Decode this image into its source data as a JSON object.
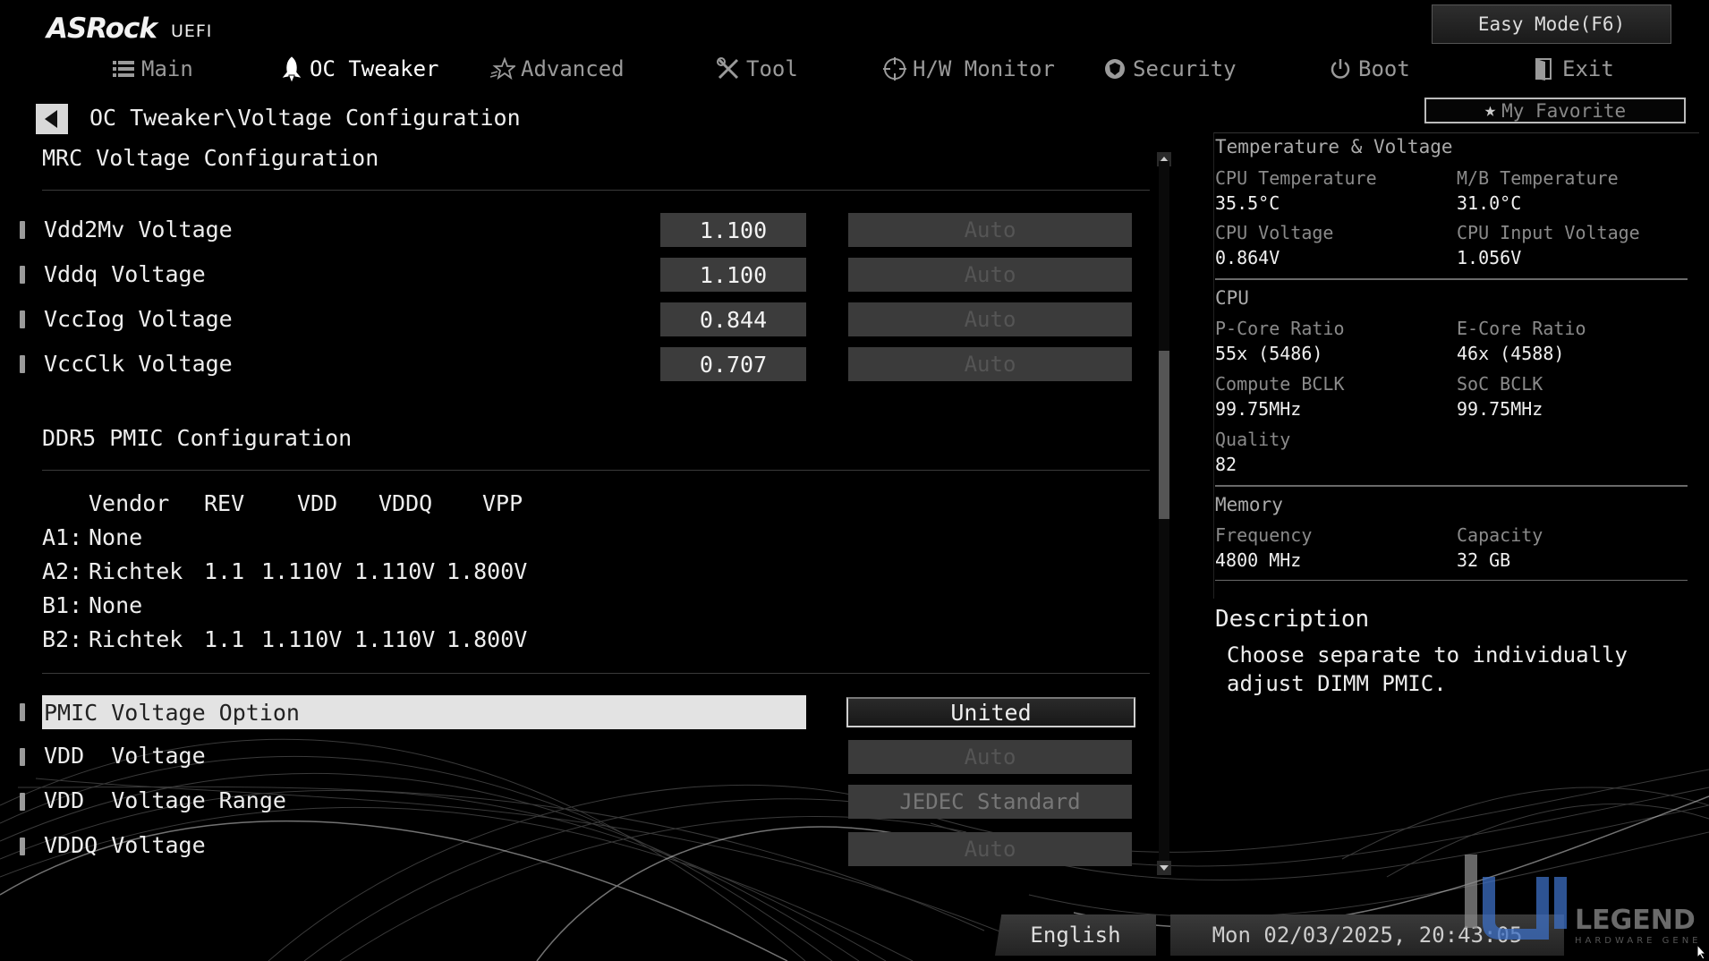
{
  "brand": {
    "logo": "ASRock",
    "uefi": "UEFI"
  },
  "header": {
    "easy_mode": "Easy Mode(F6)",
    "my_favorite": "My Favorite"
  },
  "nav": [
    {
      "label": "Main",
      "icon": "list-icon"
    },
    {
      "label": "OC Tweaker",
      "icon": "rocket-icon",
      "active": true
    },
    {
      "label": "Advanced",
      "icon": "star-icon"
    },
    {
      "label": "Tool",
      "icon": "tools-icon"
    },
    {
      "label": "H/W Monitor",
      "icon": "crosshair-icon"
    },
    {
      "label": "Security",
      "icon": "shield-icon"
    },
    {
      "label": "Boot",
      "icon": "power-icon"
    },
    {
      "label": "Exit",
      "icon": "exit-door-icon"
    }
  ],
  "breadcrumb": "OC Tweaker\\Voltage Configuration",
  "mrc": {
    "title": "MRC Voltage Configuration",
    "rows": [
      {
        "label": "Vdd2Mv Voltage",
        "value": "1.100",
        "mode": "Auto"
      },
      {
        "label": "Vddq Voltage",
        "value": "1.100",
        "mode": "Auto"
      },
      {
        "label": "VccIog Voltage",
        "value": "0.844",
        "mode": "Auto"
      },
      {
        "label": "VccClk Voltage",
        "value": "0.707",
        "mode": "Auto"
      }
    ]
  },
  "pmic": {
    "title": "DDR5 PMIC Configuration",
    "headers": [
      "Vendor",
      "REV",
      "VDD",
      "VDDQ",
      "VPP"
    ],
    "rows": [
      {
        "slot": "A1:",
        "vendor": "None",
        "rev": "",
        "vdd": "",
        "vddq": "",
        "vpp": ""
      },
      {
        "slot": "A2:",
        "vendor": "Richtek",
        "rev": "1.1",
        "vdd": "1.110V",
        "vddq": "1.110V",
        "vpp": "1.800V"
      },
      {
        "slot": "B1:",
        "vendor": "None",
        "rev": "",
        "vdd": "",
        "vddq": "",
        "vpp": ""
      },
      {
        "slot": "B2:",
        "vendor": "Richtek",
        "rev": "1.1",
        "vdd": "1.110V",
        "vddq": "1.110V",
        "vpp": "1.800V"
      }
    ]
  },
  "settings": [
    {
      "label": "PMIC Voltage Option",
      "value": "United",
      "selected": true
    },
    {
      "label": "VDD  Voltage",
      "value": "Auto"
    },
    {
      "label": "VDD  Voltage Range",
      "value": "JEDEC Standard"
    },
    {
      "label": "VDDQ Voltage",
      "value": "Auto"
    }
  ],
  "info": {
    "temp_voltage_title": "Temperature & Voltage",
    "cpu_temp_label": "CPU Temperature",
    "cpu_temp": "35.5°C",
    "mb_temp_label": "M/B Temperature",
    "mb_temp": "31.0°C",
    "cpu_voltage_label": "CPU Voltage",
    "cpu_voltage": "0.864V",
    "cpu_input_voltage_label": "CPU Input Voltage",
    "cpu_input_voltage": "1.056V",
    "cpu_title": "CPU",
    "pcore_label": "P-Core Ratio",
    "pcore": "55x (5486)",
    "ecore_label": "E-Core Ratio",
    "ecore": "46x (4588)",
    "bclk_label": "Compute BCLK",
    "bclk": "99.75MHz",
    "soc_bclk_label": "SoC BCLK",
    "soc_bclk": "99.75MHz",
    "quality_label": "Quality",
    "quality": "82",
    "memory_title": "Memory",
    "freq_label": "Frequency",
    "freq": "4800 MHz",
    "capacity_label": "Capacity",
    "capacity": "32 GB"
  },
  "description": {
    "title": "Description",
    "text": "Choose separate to individually adjust DIMM PMIC."
  },
  "footer": {
    "language": "English",
    "datetime": "Mon 02/03/2025, 20:43:05"
  },
  "watermark": {
    "logo": "LEGEND",
    "tagline": "HARDWARE GENERATION"
  },
  "colors": {
    "background": "#000000",
    "selected_row": "#e3e3e3",
    "value_box": "#3c3c3c",
    "disabled_text": "#555555"
  }
}
